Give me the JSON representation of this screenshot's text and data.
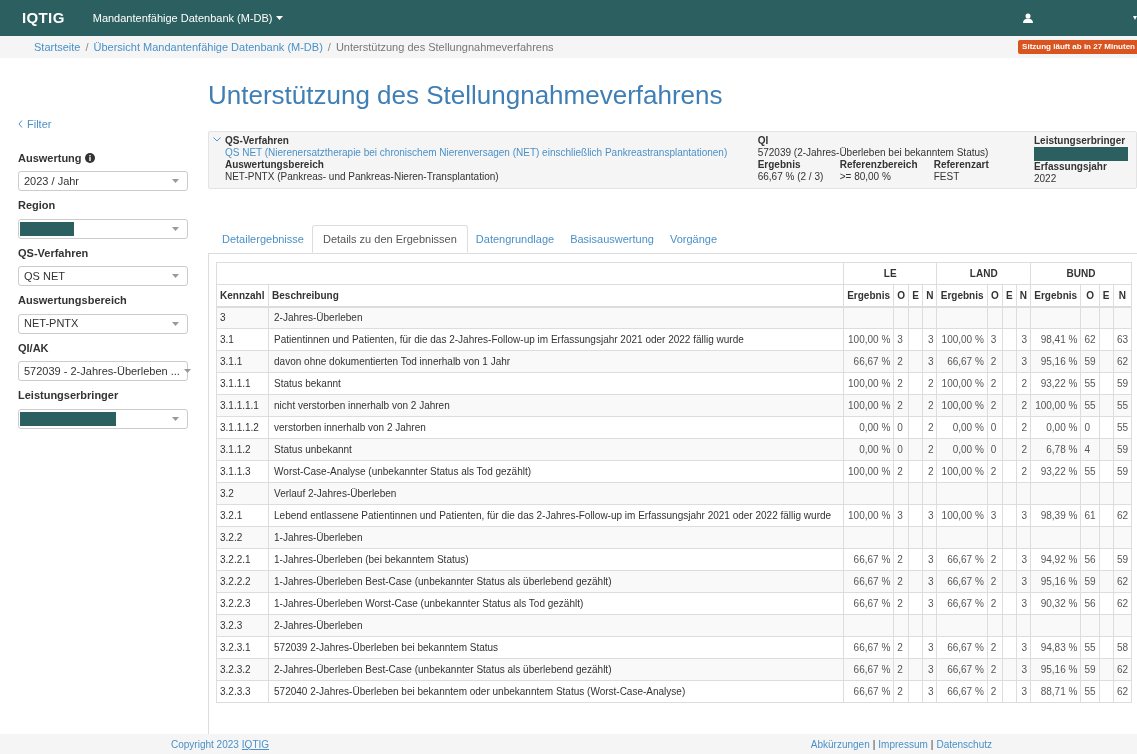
{
  "navbar": {
    "logo": "IQTIG",
    "app_menu": "Mandantenfähige Datenbank (M-DB)"
  },
  "breadcrumb": [
    {
      "label": "Startseite",
      "link": true
    },
    {
      "separator": "/",
      "label": "Übersicht Mandantenfähige Datenbank (M-DB)",
      "link": true
    },
    {
      "separator": "/",
      "label": "Unterstützung des Stellungnahmeverfahrens",
      "link": false
    }
  ],
  "session_badge": "Sitzung läuft ab in 27 Minuten",
  "sidebar": {
    "back_link": "Filter",
    "filters": [
      {
        "label": "Auswertung",
        "info": true,
        "value": "2023 / Jahr",
        "redacted": false
      },
      {
        "label": "Region",
        "info": false,
        "redacted": true
      },
      {
        "label": "QS-Verfahren",
        "info": false,
        "value": "QS NET",
        "redacted": false
      },
      {
        "label": "Auswertungsbereich",
        "info": false,
        "value": "NET-PNTX",
        "redacted": false
      },
      {
        "label": "QI/AK",
        "info": false,
        "value": "572039 - 2-Jahres-Überleben ...",
        "redacted": false
      },
      {
        "label": "Leistungserbringer",
        "info": false,
        "redacted": true
      }
    ]
  },
  "page_title": "Unterstützung des Stellungnahmeverfahrens",
  "summary": {
    "expanded": true,
    "qs_verfahren": {
      "label": "QS-Verfahren",
      "value": "QS NET (Nierenersatztherapie bei chronischem Nierenversagen (NET) einschließlich Pankreastransplantationen)"
    },
    "auswertungsbereich": {
      "label": "Auswertungsbereich",
      "value": "NET-PNTX (Pankreas- und Pankreas-Nieren-Transplantation)"
    },
    "qi": {
      "label": "QI",
      "value": "572039 (2-Jahres-Überleben bei bekanntem Status)"
    },
    "ergebnis": {
      "label": "Ergebnis",
      "value": "66,67 % (2 / 3)"
    },
    "referenzbereich": {
      "label": "Referenzbereich",
      "value": ">= 80,00 %"
    },
    "referenzart": {
      "label": "Referenzart",
      "value": "FEST"
    },
    "leistungserbringer": {
      "label": "Leistungserbringer",
      "redacted": true
    },
    "erfassungsjahr": {
      "label": "Erfassungsjahr",
      "value": "2022"
    }
  },
  "tabs": [
    {
      "label": "Detailergebnisse",
      "selected": false
    },
    {
      "label": "Details zu den Ergebnissen",
      "selected": true
    },
    {
      "label": "Datengrundlage",
      "selected": false
    },
    {
      "label": "Basisauswertung",
      "selected": false
    },
    {
      "label": "Vorgänge",
      "selected": false
    }
  ],
  "table": {
    "groups": [
      {
        "label": "LE",
        "sub_columns": [
          "Ergebnis",
          "O",
          "E",
          "N"
        ]
      },
      {
        "label": "LAND",
        "sub_columns": [
          "Ergebnis",
          "O",
          "E",
          "N"
        ]
      },
      {
        "label": "BUND",
        "sub_columns": [
          "Ergebnis",
          "O",
          "E",
          "N"
        ]
      }
    ],
    "columns": [
      "Kennzahl",
      "Beschreibung"
    ],
    "rows": [
      {
        "kennzahl": "3",
        "beschreibung": "2-Jahres-Überleben"
      },
      {
        "kennzahl": "3.1",
        "beschreibung": "Patientinnen und Patienten, für die das 2-Jahres-Follow-up im Erfassungsjahr 2021 oder 2022 fällig wurde",
        "values": [
          [
            "100,00 %",
            "3",
            "3"
          ],
          [
            "100,00 %",
            "3",
            "3"
          ],
          [
            "98,41 %",
            "62",
            "63"
          ]
        ]
      },
      {
        "kennzahl": "3.1.1",
        "beschreibung": "davon ohne dokumentierten Tod innerhalb von 1 Jahr",
        "values": [
          [
            "66,67 %",
            "2",
            "3"
          ],
          [
            "66,67 %",
            "2",
            "3"
          ],
          [
            "95,16 %",
            "59",
            "62"
          ]
        ]
      },
      {
        "kennzahl": "3.1.1.1",
        "beschreibung": "Status bekannt",
        "values": [
          [
            "100,00 %",
            "2",
            "2"
          ],
          [
            "100,00 %",
            "2",
            "2"
          ],
          [
            "93,22 %",
            "55",
            "59"
          ]
        ]
      },
      {
        "kennzahl": "3.1.1.1.1",
        "beschreibung": "nicht verstorben innerhalb von 2 Jahren",
        "values": [
          [
            "100,00 %",
            "2",
            "2"
          ],
          [
            "100,00 %",
            "2",
            "2"
          ],
          [
            "100,00 %",
            "55",
            "55"
          ]
        ]
      },
      {
        "kennzahl": "3.1.1.1.2",
        "beschreibung": "verstorben innerhalb von 2 Jahren",
        "values": [
          [
            "0,00 %",
            "0",
            "2"
          ],
          [
            "0,00 %",
            "0",
            "2"
          ],
          [
            "0,00 %",
            "0",
            "55"
          ]
        ]
      },
      {
        "kennzahl": "3.1.1.2",
        "beschreibung": "Status unbekannt",
        "values": [
          [
            "0,00 %",
            "0",
            "2"
          ],
          [
            "0,00 %",
            "0",
            "2"
          ],
          [
            "6,78 %",
            "4",
            "59"
          ]
        ]
      },
      {
        "kennzahl": "3.1.1.3",
        "beschreibung": "Worst-Case-Analyse (unbekannter Status als Tod gezählt)",
        "values": [
          [
            "100,00 %",
            "2",
            "2"
          ],
          [
            "100,00 %",
            "2",
            "2"
          ],
          [
            "93,22 %",
            "55",
            "59"
          ]
        ]
      },
      {
        "kennzahl": "3.2",
        "beschreibung": "Verlauf 2-Jahres-Überleben"
      },
      {
        "kennzahl": "3.2.1",
        "beschreibung": "Lebend entlassene Patientinnen und Patienten, für die das 2-Jahres-Follow-up im Erfassungsjahr 2021 oder 2022 fällig wurde",
        "values": [
          [
            "100,00 %",
            "3",
            "3"
          ],
          [
            "100,00 %",
            "3",
            "3"
          ],
          [
            "98,39 %",
            "61",
            "62"
          ]
        ]
      },
      {
        "kennzahl": "3.2.2",
        "beschreibung": "1-Jahres-Überleben"
      },
      {
        "kennzahl": "3.2.2.1",
        "beschreibung": "1-Jahres-Überleben (bei bekanntem Status)",
        "values": [
          [
            "66,67 %",
            "2",
            "3"
          ],
          [
            "66,67 %",
            "2",
            "3"
          ],
          [
            "94,92 %",
            "56",
            "59"
          ]
        ]
      },
      {
        "kennzahl": "3.2.2.2",
        "beschreibung": "1-Jahres-Überleben Best-Case (unbekannter Status als überlebend gezählt)",
        "values": [
          [
            "66,67 %",
            "2",
            "3"
          ],
          [
            "66,67 %",
            "2",
            "3"
          ],
          [
            "95,16 %",
            "59",
            "62"
          ]
        ]
      },
      {
        "kennzahl": "3.2.2.3",
        "beschreibung": "1-Jahres-Überleben Worst-Case (unbekannter Status als Tod gezählt)",
        "values": [
          [
            "66,67 %",
            "2",
            "3"
          ],
          [
            "66,67 %",
            "2",
            "3"
          ],
          [
            "90,32 %",
            "56",
            "62"
          ]
        ]
      },
      {
        "kennzahl": "3.2.3",
        "beschreibung": "2-Jahres-Überleben"
      },
      {
        "kennzahl": "3.2.3.1",
        "beschreibung": "572039 2-Jahres-Überleben bei bekanntem Status",
        "values": [
          [
            "66,67 %",
            "2",
            "3"
          ],
          [
            "66,67 %",
            "2",
            "3"
          ],
          [
            "94,83 %",
            "55",
            "58"
          ]
        ]
      },
      {
        "kennzahl": "3.2.3.2",
        "beschreibung": "2-Jahres-Überleben Best-Case (unbekannter Status als überlebend gezählt)",
        "values": [
          [
            "66,67 %",
            "2",
            "3"
          ],
          [
            "66,67 %",
            "2",
            "3"
          ],
          [
            "95,16 %",
            "59",
            "62"
          ]
        ]
      },
      {
        "kennzahl": "3.2.3.3",
        "beschreibung": "572040 2-Jahres-Überleben bei bekanntem oder unbekanntem Status (Worst-Case-Analyse)",
        "values": [
          [
            "66,67 %",
            "2",
            "3"
          ],
          [
            "66,67 %",
            "2",
            "3"
          ],
          [
            "88,71 %",
            "55",
            "62"
          ]
        ]
      }
    ]
  },
  "footer": {
    "copyright": "Copyright 2023",
    "copyright_link": "IQTIG",
    "links": [
      {
        "label": "Abkürzungen"
      },
      {
        "separator": "|",
        "label": "Impressum"
      },
      {
        "separator": "|",
        "label": "Datenschutz"
      }
    ]
  }
}
